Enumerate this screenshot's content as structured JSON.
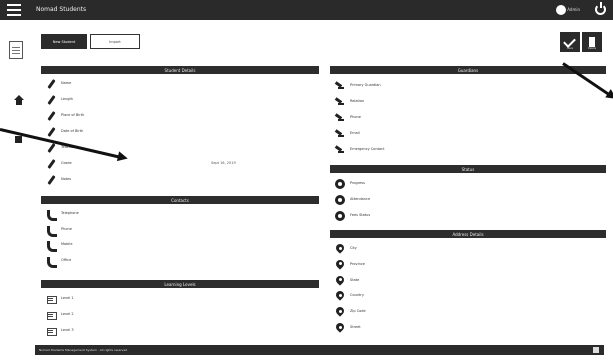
{
  "header": {
    "title": "Nomad Students",
    "user_name": "Admin",
    "menu_icon": "hamburger-menu-icon",
    "user_icon": "user-avatar-icon",
    "power_icon": "power-icon"
  },
  "actions": {
    "primary_label": "New Student",
    "secondary_label": "Import",
    "save_label": "Save",
    "delete_label": "Delete"
  },
  "sections": {
    "details": {
      "title": "Student Details",
      "rows": [
        {
          "label": "Name",
          "value": ""
        },
        {
          "label": "Length",
          "value": ""
        },
        {
          "label": "Place of Birth",
          "value": ""
        },
        {
          "label": "Date of Birth",
          "value": ""
        },
        {
          "label": "Teacher",
          "value": ""
        },
        {
          "label": "Grade",
          "value": "Sept 16, 2019"
        },
        {
          "label": "Notes",
          "value": ""
        }
      ]
    },
    "contacts": {
      "title": "Contacts",
      "rows": [
        {
          "label": "Telephone"
        },
        {
          "label": "Phone"
        },
        {
          "label": "Mobile"
        },
        {
          "label": "Office"
        }
      ]
    },
    "learning": {
      "title": "Learning Levels",
      "rows": [
        {
          "label": "Level 1",
          "value": ""
        },
        {
          "label": "Level 2",
          "value": ""
        },
        {
          "label": "Level 3",
          "value": ""
        }
      ]
    },
    "guardians": {
      "title": "Guardians",
      "rows": [
        {
          "label": "Primary Guardian",
          "value": ""
        },
        {
          "label": "Relation",
          "value": ""
        },
        {
          "label": "Phone",
          "value": ""
        },
        {
          "label": "Email",
          "value": ""
        },
        {
          "label": "Emergency Contact",
          "value": ""
        }
      ]
    },
    "status": {
      "title": "Status",
      "rows": [
        {
          "label": "Progress"
        },
        {
          "label": "Attendance"
        },
        {
          "label": "Fees Status"
        }
      ]
    },
    "address": {
      "title": "Address Details",
      "rows": [
        {
          "label": "City"
        },
        {
          "label": "Province"
        },
        {
          "label": "State"
        },
        {
          "label": "Country"
        },
        {
          "label": "Zip Code",
          "value": ""
        },
        {
          "label": "Street"
        }
      ]
    }
  },
  "footer": {
    "text": "Nomad Students Management System · All rights reserved"
  },
  "colors": {
    "bar": "#2b2b2b",
    "accent": "#111111"
  }
}
